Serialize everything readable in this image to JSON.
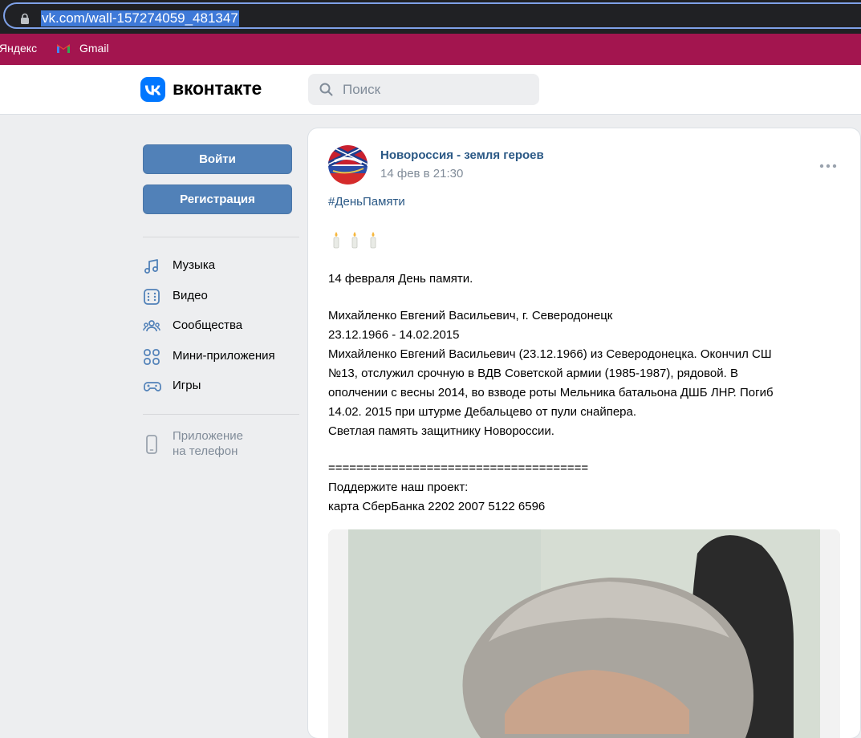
{
  "browser": {
    "url": "vk.com/wall-157274059_481347",
    "bookmarks": [
      {
        "label": "Яндекс"
      },
      {
        "label": "Gmail"
      }
    ]
  },
  "header": {
    "logo_text": "вконтакте",
    "search_placeholder": "Поиск"
  },
  "sidebar": {
    "login_label": "Войти",
    "register_label": "Регистрация",
    "nav": [
      {
        "label": "Музыка",
        "icon": "music-icon"
      },
      {
        "label": "Видео",
        "icon": "video-icon"
      },
      {
        "label": "Сообщества",
        "icon": "communities-icon"
      },
      {
        "label": "Мини-приложения",
        "icon": "mini-apps-icon"
      },
      {
        "label": "Игры",
        "icon": "games-icon"
      }
    ],
    "phone_app_line1": "Приложение",
    "phone_app_line2": "на телефон"
  },
  "post": {
    "group_name": "Новороссия - земля героев",
    "date": "14 фев в 21:30",
    "hashtag": "#ДеньПамяти",
    "candles": "🕯️🕯️🕯️",
    "lines": [
      "14 февраля День памяти.",
      "Михайленко Евгений Васильевич, г. Северодонецк",
      "23.12.1966 - 14.02.2015",
      "Михайленко Евгений Васильевич (23.12.1966) из Северодонецка. Окончил СШ",
      "№13, отслужил срочную в ВДВ Советской армии (1985-1987), рядовой. В",
      "ополчении с весны 2014, во взводе роты Мельника батальона ДШБ ЛНР. Погиб",
      "14.02. 2015 при штурме Дебальцево от пули снайпера.",
      "Светлая память защитнику Новороссии.",
      "=====================================",
      "Поддержите наш проект:",
      "карта СберБанка 2202 2007 5122 6596"
    ]
  },
  "colors": {
    "vk_blue": "#0077ff",
    "button_blue": "#5181b8",
    "link_blue": "#2a5885",
    "bookmarks_bar": "#a3154f"
  }
}
